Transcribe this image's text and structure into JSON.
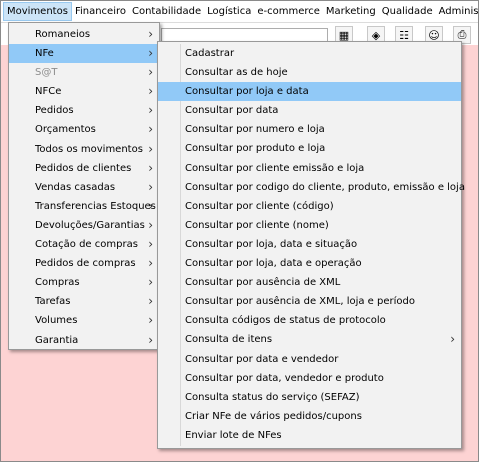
{
  "menubar": {
    "items": [
      "Movimentos",
      "Financeiro",
      "Contabilidade",
      "Logística",
      "e-commerce",
      "Marketing",
      "Qualidade",
      "Administraç"
    ]
  },
  "movimentos_menu": {
    "items": [
      {
        "label": "Romaneios",
        "submenu": true
      },
      {
        "label": "NFe",
        "submenu": true,
        "state": "highlighted"
      },
      {
        "label": "S@T",
        "submenu": true,
        "state": "disabled"
      },
      {
        "label": "NFCe",
        "submenu": true
      },
      {
        "label": "Pedidos",
        "submenu": true
      },
      {
        "label": "Orçamentos",
        "submenu": true
      },
      {
        "label": "Todos os movimentos",
        "submenu": true
      },
      {
        "label": "Pedidos de clientes",
        "submenu": true
      },
      {
        "label": "Vendas casadas",
        "submenu": true
      },
      {
        "label": "Transferencias Estoques",
        "submenu": true
      },
      {
        "label": "Devoluções/Garantias",
        "submenu": true
      },
      {
        "label": "Cotação de compras",
        "submenu": true
      },
      {
        "label": "Pedidos de compras",
        "submenu": true
      },
      {
        "label": "Compras",
        "submenu": true
      },
      {
        "label": "Tarefas",
        "submenu": true
      },
      {
        "label": "Volumes",
        "submenu": true
      },
      {
        "label": "Garantia",
        "submenu": true
      }
    ]
  },
  "nfe_submenu": {
    "items": [
      {
        "label": "Cadastrar"
      },
      {
        "label": "Consultar as de hoje"
      },
      {
        "label": "Consultar por loja e data",
        "state": "highlighted"
      },
      {
        "label": "Consultar por data"
      },
      {
        "label": "Consultar por numero e loja"
      },
      {
        "label": "Consultar por produto e loja"
      },
      {
        "label": "Consultar por cliente emissão e loja"
      },
      {
        "label": "Consultar por codigo do cliente, produto, emissão e loja"
      },
      {
        "label": "Consultar por cliente (código)"
      },
      {
        "label": "Consultar por cliente (nome)"
      },
      {
        "label": "Consultar por loja, data e situação"
      },
      {
        "label": "Consultar por loja, data e operação"
      },
      {
        "label": "Consultar por ausência de XML"
      },
      {
        "label": "Consultar por ausência de XML, loja e período"
      },
      {
        "label": "Consulta códigos de status de protocolo"
      },
      {
        "label": "Consulta de itens",
        "submenu": true
      },
      {
        "label": "Consultar por data e vendedor"
      },
      {
        "label": "Consultar por data, vendedor e produto"
      },
      {
        "label": "Consulta status do serviço (SEFAZ)"
      },
      {
        "label": "Criar NFe de vários pedidos/cupons"
      },
      {
        "label": "Enviar lote de NFes"
      }
    ]
  },
  "toolbar": {
    "icons": [
      "calculator-icon",
      "box-icon",
      "contacts-icon",
      "users-icon",
      "printer-icon"
    ]
  },
  "colors": {
    "background": "#fdd3d3",
    "menu_highlight": "#91c9f7",
    "menubar_active": "#cce4f7"
  }
}
